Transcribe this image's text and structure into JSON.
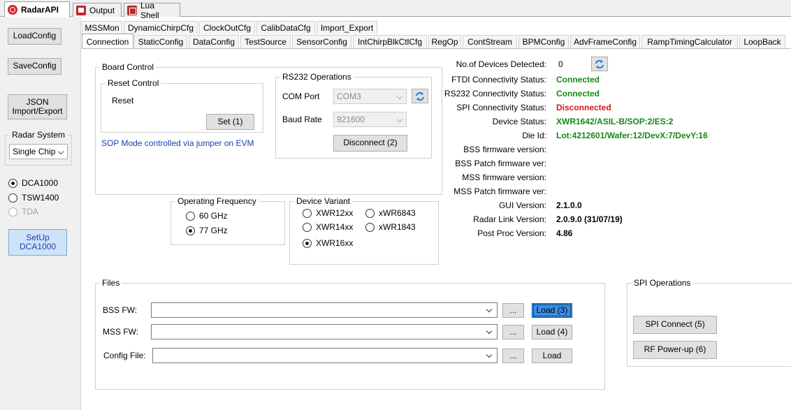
{
  "window_tabs": [
    {
      "label": "RadarAPI",
      "icon": "radar-api-icon"
    },
    {
      "label": "Output",
      "icon": "output-icon"
    },
    {
      "label": "Lua Shell",
      "icon": "lua-shell-icon"
    }
  ],
  "sidebar": {
    "load_config": "LoadConfig",
    "save_config": "SaveConfig",
    "json_line1": "JSON",
    "json_line2": "Import/Export",
    "radar_system_title": "Radar System",
    "radar_system_value": "Single Chip",
    "capture_options": [
      {
        "label": "DCA1000",
        "selected": true,
        "enabled": true
      },
      {
        "label": "TSW1400",
        "selected": false,
        "enabled": true
      },
      {
        "label": "TDA",
        "selected": false,
        "enabled": false
      }
    ],
    "setup_line1": "SetUp",
    "setup_line2": "DCA1000"
  },
  "tabs_row1": [
    "MSSMon",
    "DynamicChirpCfg",
    "ClockOutCfg",
    "CalibDataCfg",
    "Import_Export"
  ],
  "tabs_row2": [
    "Connection",
    "StaticConfig",
    "DataConfig",
    "TestSource",
    "SensorConfig",
    "IntChirpBlkCtlCfg",
    "RegOp",
    "ContStream",
    "BPMConfig",
    "AdvFrameConfig",
    "RampTimingCalculator",
    "LoopBack"
  ],
  "board_control": {
    "title": "Board Control",
    "reset_title": "Reset Control",
    "reset_label": "Reset",
    "set_button": "Set (1)",
    "sop_note": "SOP Mode controlled via jumper on EVM"
  },
  "rs232": {
    "title": "RS232 Operations",
    "com_label": "COM Port",
    "com_value": "COM3",
    "baud_label": "Baud Rate",
    "baud_value": "921600",
    "disconnect_button": "Disconnect (2)"
  },
  "operating_frequency": {
    "title": "Operating Frequency",
    "options": [
      {
        "label": "60 GHz",
        "selected": false
      },
      {
        "label": "77 GHz",
        "selected": true
      }
    ]
  },
  "device_variant": {
    "title": "Device Variant",
    "options": [
      {
        "label": "XWR12xx",
        "selected": false
      },
      {
        "label": "xWR6843",
        "selected": false
      },
      {
        "label": "XWR14xx",
        "selected": false
      },
      {
        "label": "xWR1843",
        "selected": false
      },
      {
        "label": "XWR16xx",
        "selected": true
      }
    ]
  },
  "status": {
    "devices_label": "No.of Devices Detected:",
    "devices_value": "0",
    "rows": [
      {
        "label": "FTDI Connectivity Status:",
        "value": "Connected",
        "kind": "green"
      },
      {
        "label": "RS232 Connectivity Status:",
        "value": "Connected",
        "kind": "green"
      },
      {
        "label": "SPI Connectivity Status:",
        "value": "Disconnected",
        "kind": "red"
      },
      {
        "label": "Device Status:",
        "value": "XWR1642/ASIL-B/SOP:2/ES:2",
        "kind": "green"
      },
      {
        "label": "Die Id:",
        "value": "Lot:4212601/Wafer:12/DevX:7/DevY:16",
        "kind": "green"
      },
      {
        "label": "BSS firmware version:",
        "value": "",
        "kind": "plain"
      },
      {
        "label": "BSS Patch firmware ver:",
        "value": "",
        "kind": "plain"
      },
      {
        "label": "MSS firmware version:",
        "value": "",
        "kind": "plain"
      },
      {
        "label": "MSS Patch firmware ver:",
        "value": "",
        "kind": "plain"
      },
      {
        "label": "GUI Version:",
        "value": "2.1.0.0",
        "kind": "bold"
      },
      {
        "label": "Radar Link Version:",
        "value": "2.0.9.0 (31/07/19)",
        "kind": "bold"
      },
      {
        "label": "Post Proc Version:",
        "value": "4.86",
        "kind": "bold"
      }
    ]
  },
  "files": {
    "title": "Files",
    "rows": [
      {
        "label": "BSS FW:",
        "browse": "...",
        "load": "Load (3)",
        "selected": true
      },
      {
        "label": "MSS FW:",
        "browse": "...",
        "load": "Load (4)",
        "selected": false
      },
      {
        "label": "Config File:",
        "browse": "...",
        "load": "Load",
        "selected": false
      }
    ]
  },
  "spi": {
    "title": "SPI Operations",
    "connect_button": "SPI Connect (5)",
    "power_button": "RF Power-up (6)"
  },
  "colors": {
    "connected": "#138a13",
    "disconnected": "#d11a1a",
    "link_blue": "#1a3fb5"
  }
}
